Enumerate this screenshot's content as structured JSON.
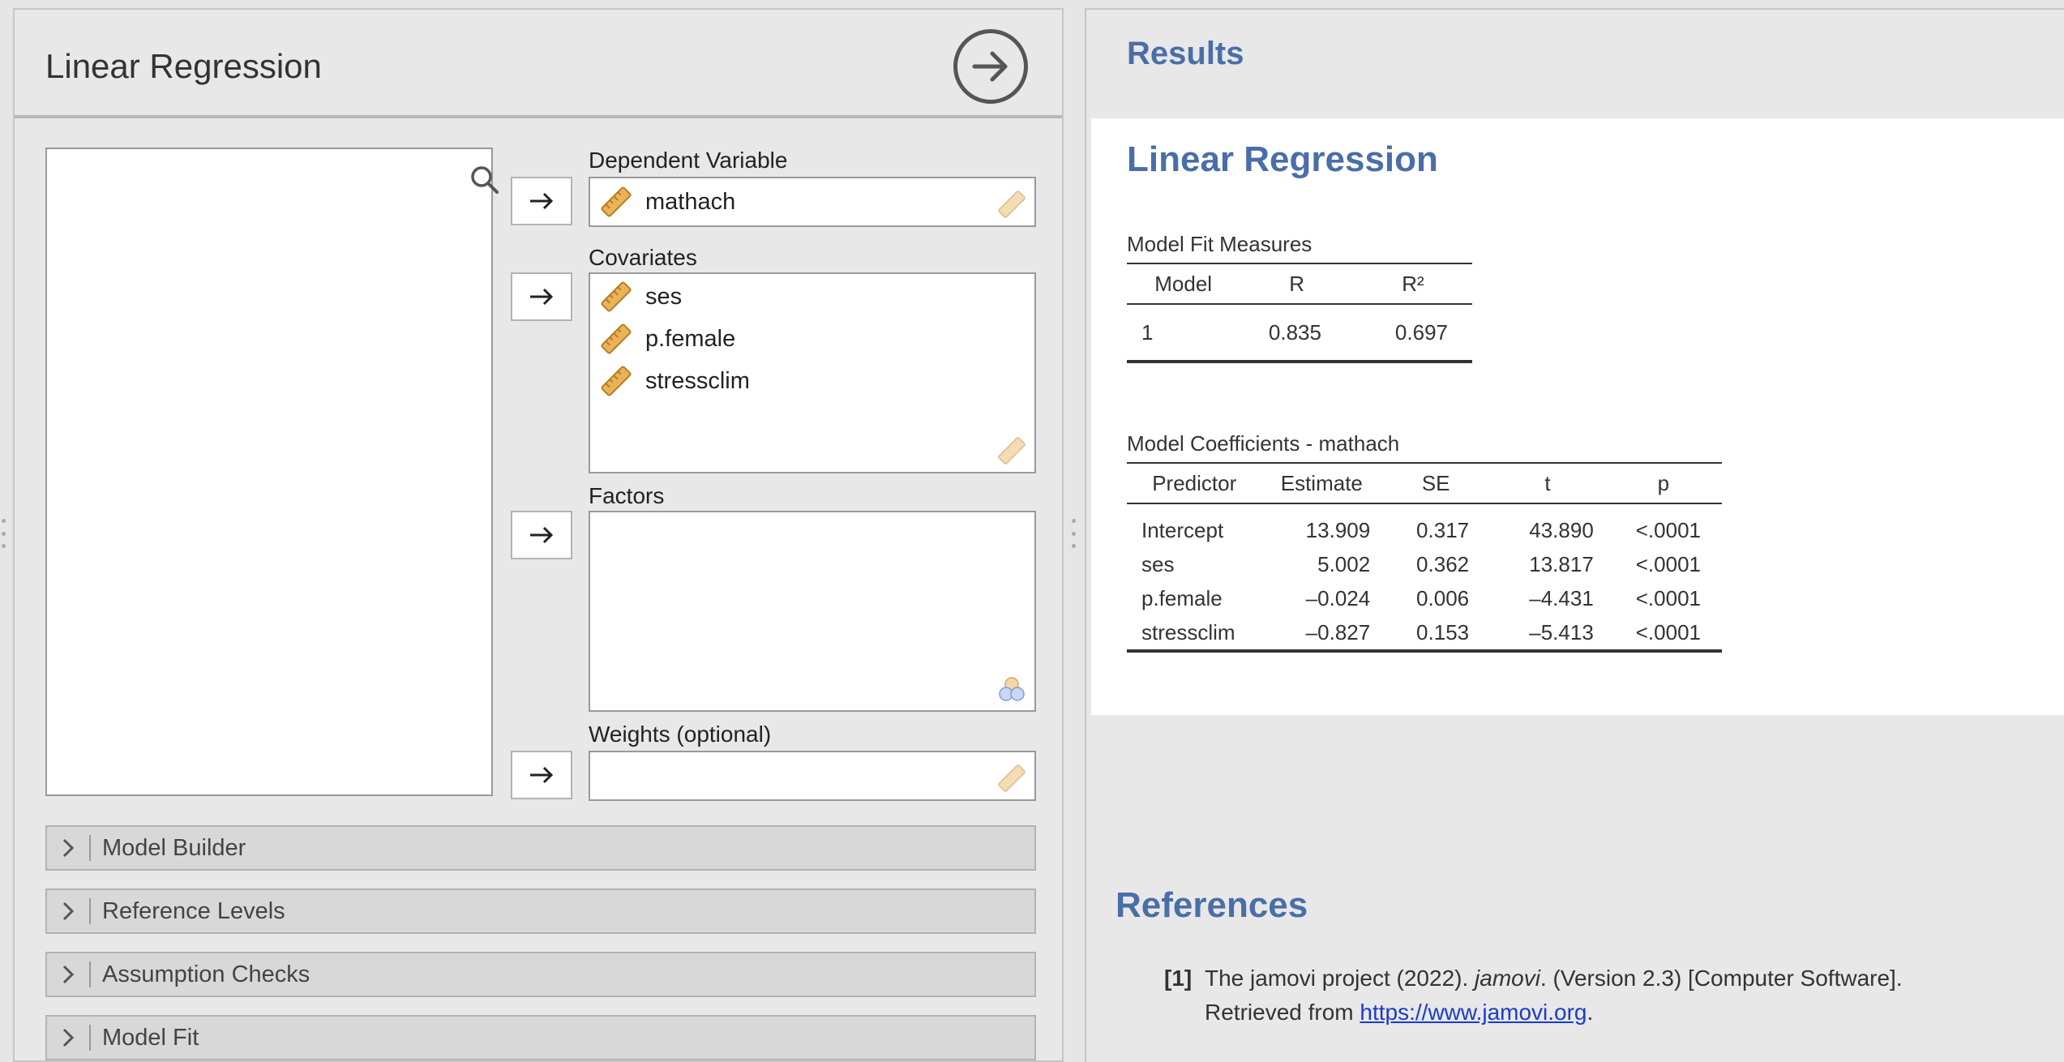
{
  "options": {
    "title": "Linear Regression",
    "dependent_label": "Dependent Variable",
    "dependent_value": "mathach",
    "covariates_label": "Covariates",
    "covariates": [
      "ses",
      "p.female",
      "stressclim"
    ],
    "factors_label": "Factors",
    "weights_label": "Weights (optional)",
    "sections": [
      "Model Builder",
      "Reference Levels",
      "Assumption Checks",
      "Model Fit"
    ]
  },
  "results": {
    "heading": "Results",
    "analysis_title": "Linear Regression",
    "model_fit": {
      "title": "Model Fit Measures",
      "columns": [
        "Model",
        "R",
        "R²"
      ],
      "rows": [
        [
          "1",
          "0.835",
          "0.697"
        ]
      ]
    },
    "coefficients": {
      "title": "Model Coefficients - mathach",
      "columns": [
        "Predictor",
        "Estimate",
        "SE",
        "t",
        "p"
      ],
      "rows": [
        [
          "Intercept",
          "13.909",
          "0.317",
          "43.890",
          "<.0001"
        ],
        [
          "ses",
          "5.002",
          "0.362",
          "13.817",
          "<.0001"
        ],
        [
          "p.female",
          "–0.024",
          "0.006",
          "–4.431",
          "<.0001"
        ],
        [
          "stressclim",
          "–0.827",
          "0.153",
          "–5.413",
          "<.0001"
        ]
      ]
    },
    "references_heading": "References",
    "reference": {
      "number": "[1]",
      "text_before": "The jamovi project (2022). ",
      "italic": "jamovi",
      "text_after": ". (Version 2.3) [Computer Software]. Retrieved from ",
      "link": "https://www.jamovi.org",
      "text_end": "."
    }
  },
  "colors": {
    "accent_blue": "#4a6ea8",
    "ruler_icon": "#e8b04a",
    "link": "#1a3cc8"
  },
  "icons": [
    "run-arrow-icon",
    "search-icon",
    "right-arrow-icon",
    "ruler-icon",
    "nominal-icon",
    "chevron-right-icon"
  ]
}
